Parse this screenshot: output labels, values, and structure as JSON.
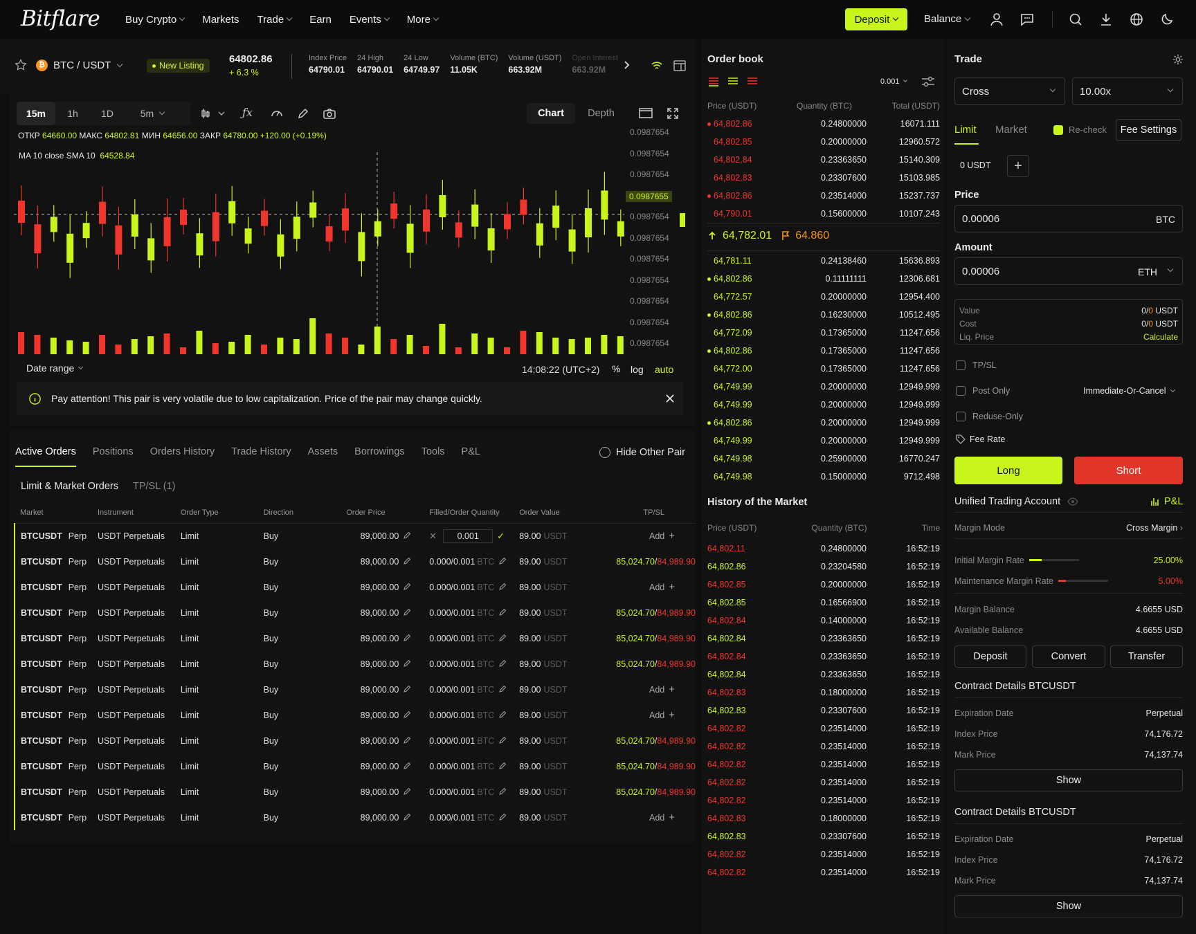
{
  "brand": "Bitflare",
  "nav": [
    "Buy Crypto",
    "Markets",
    "Trade",
    "Earn",
    "Events",
    "More"
  ],
  "nav_has_chevron": [
    true,
    false,
    true,
    false,
    true,
    true
  ],
  "header": {
    "deposit": "Deposit",
    "balance": "Balance"
  },
  "pair": {
    "symbol": "BTC / USDT",
    "badge": "New Listing",
    "price": "64802.86",
    "change": "+ 6.3 %",
    "stats": [
      {
        "label": "Index Price",
        "value": "64790.01"
      },
      {
        "label": "24 High",
        "value": "64790.01"
      },
      {
        "label": "24 Low",
        "value": "64749.97"
      },
      {
        "label": "Volume (BTC)",
        "value": "11.05K"
      },
      {
        "label": "Volume (USDT)",
        "value": "663.92M"
      },
      {
        "label": "Open Interest",
        "value": "663.92M"
      }
    ]
  },
  "chart_toolbar": {
    "intervals": [
      "15m",
      "1h",
      "1D",
      "5m"
    ],
    "active": "15m",
    "views": [
      "Chart",
      "Depth"
    ],
    "active_view": "Chart"
  },
  "ohlc": {
    "o_label": "ОТКР",
    "o": "64660.00",
    "h_label": "МАКС",
    "h": "64802.81",
    "l_label": "МИН",
    "l": "64656.00",
    "c_label": "ЗАКР",
    "c": "64780.00",
    "chg": "+120.00 (+0.19%)"
  },
  "ma": {
    "label": "MA 10 close SMA 10",
    "value": "64528.84"
  },
  "price_axis": [
    "0.0987654",
    "0.0987654",
    "0.0987654",
    "0.0987655",
    "0.0987654",
    "0.0987654",
    "0.0987654",
    "0.0987654",
    "0.0987654",
    "0.0987654",
    "0.0987654"
  ],
  "chart_bottom": {
    "date_range": "Date range",
    "time": "14:08:22 (UTC+2)",
    "pct": "%",
    "log": "log",
    "auto": "auto"
  },
  "warning": "Pay attention! This pair is very volatile due to low capitalization. Price of the pair may change quickly.",
  "orders": {
    "tabs": [
      "Active Orders",
      "Positions",
      "Orders History",
      "Trade History",
      "Assets",
      "Borrowings",
      "Tools",
      "P&L"
    ],
    "active_tab": "Active Orders",
    "hide_other": "Hide Other Pair",
    "subtabs": [
      "Limit & Market Orders",
      "TP/SL (1)"
    ],
    "columns": [
      "Market",
      "Instrument",
      "Order Type",
      "Direction",
      "Order Price",
      "Filled/Order Quantity",
      "Order Value",
      "TP/SL"
    ],
    "rows": [
      {
        "market": "BTCUSDT",
        "kind": "Perp",
        "instrument": "USDT Perpetuals",
        "type": "Limit",
        "dir": "Buy",
        "price": "89,000.00",
        "qty": "",
        "value": "89.00",
        "unit": "USDT",
        "tp": "",
        "sl": "",
        "add": "Add",
        "edit_qty": "0.001"
      },
      {
        "market": "BTCUSDT",
        "kind": "Perp",
        "instrument": "USDT Perpetuals",
        "type": "Limit",
        "dir": "Buy",
        "price": "89,000.00",
        "qty": "0.000/0.001",
        "value": "89.00",
        "unit": "USDT",
        "tp": "85,024.70",
        "sl": "84,989.90",
        "add": ""
      },
      {
        "market": "BTCUSDT",
        "kind": "Perp",
        "instrument": "USDT Perpetuals",
        "type": "Limit",
        "dir": "Buy",
        "price": "89,000.00",
        "qty": "0.000/0.001",
        "value": "89.00",
        "unit": "USDT",
        "tp": "",
        "sl": "",
        "add": "Add"
      },
      {
        "market": "BTCUSDT",
        "kind": "Perp",
        "instrument": "USDT Perpetuals",
        "type": "Limit",
        "dir": "Buy",
        "price": "89,000.00",
        "qty": "0.000/0.001",
        "value": "89.00",
        "unit": "USDT",
        "tp": "85,024.70",
        "sl": "84,989.90",
        "add": ""
      },
      {
        "market": "BTCUSDT",
        "kind": "Perp",
        "instrument": "USDT Perpetuals",
        "type": "Limit",
        "dir": "Buy",
        "price": "89,000.00",
        "qty": "0.000/0.001",
        "value": "89.00",
        "unit": "USDT",
        "tp": "85,024.70",
        "sl": "84,989.90",
        "add": ""
      },
      {
        "market": "BTCUSDT",
        "kind": "Perp",
        "instrument": "USDT Perpetuals",
        "type": "Limit",
        "dir": "Buy",
        "price": "89,000.00",
        "qty": "0.000/0.001",
        "value": "89.00",
        "unit": "USDT",
        "tp": "85,024.70",
        "sl": "84,989.90",
        "add": ""
      },
      {
        "market": "BTCUSDT",
        "kind": "Perp",
        "instrument": "USDT Perpetuals",
        "type": "Limit",
        "dir": "Buy",
        "price": "89,000.00",
        "qty": "0.000/0.001",
        "value": "89.00",
        "unit": "USDT",
        "tp": "",
        "sl": "",
        "add": "Add"
      },
      {
        "market": "BTCUSDT",
        "kind": "Perp",
        "instrument": "USDT Perpetuals",
        "type": "Limit",
        "dir": "Buy",
        "price": "89,000.00",
        "qty": "0.000/0.001",
        "value": "89.00",
        "unit": "USDT",
        "tp": "",
        "sl": "",
        "add": "Add"
      },
      {
        "market": "BTCUSDT",
        "kind": "Perp",
        "instrument": "USDT Perpetuals",
        "type": "Limit",
        "dir": "Buy",
        "price": "89,000.00",
        "qty": "0.000/0.001",
        "value": "89.00",
        "unit": "USDT",
        "tp": "85,024.70",
        "sl": "84,989.90",
        "add": ""
      },
      {
        "market": "BTCUSDT",
        "kind": "Perp",
        "instrument": "USDT Perpetuals",
        "type": "Limit",
        "dir": "Buy",
        "price": "89,000.00",
        "qty": "0.000/0.001",
        "value": "89.00",
        "unit": "USDT",
        "tp": "85,024.70",
        "sl": "84,989.90",
        "add": ""
      },
      {
        "market": "BTCUSDT",
        "kind": "Perp",
        "instrument": "USDT Perpetuals",
        "type": "Limit",
        "dir": "Buy",
        "price": "89,000.00",
        "qty": "0.000/0.001",
        "value": "89.00",
        "unit": "USDT",
        "tp": "85,024.70",
        "sl": "84,989.90",
        "add": ""
      },
      {
        "market": "BTCUSDT",
        "kind": "Perp",
        "instrument": "USDT Perpetuals",
        "type": "Limit",
        "dir": "Buy",
        "price": "89,000.00",
        "qty": "0.000/0.001",
        "value": "89.00",
        "unit": "USDT",
        "tp": "",
        "sl": "",
        "add": "Add"
      }
    ]
  },
  "orderbook": {
    "title": "Order book",
    "precision": "0.001",
    "columns": [
      "Price (USDT)",
      "Quantity (BTC)",
      "Total (USDT)"
    ],
    "asks": [
      [
        "64,802.86",
        "0.24800000",
        "16071.111",
        true
      ],
      [
        "64,802.85",
        "0.20000000",
        "12960.572",
        false
      ],
      [
        "64,802.84",
        "0.23363650",
        "15140.309",
        false
      ],
      [
        "64,802.83",
        "0.23307600",
        "15103.985",
        false
      ],
      [
        "64,802.86",
        "0.23514000",
        "15237.737",
        true
      ],
      [
        "64,790.01",
        "0.15600000",
        "10107.243",
        false
      ]
    ],
    "last_price": "64,782.01",
    "mark_price": "64.860",
    "bids": [
      [
        "64,781.11",
        "0.24138460",
        "15636.893",
        false
      ],
      [
        "64,802.86",
        "0.11111111",
        "12306.681",
        true
      ],
      [
        "64,772.57",
        "0.20000000",
        "12954.400",
        false
      ],
      [
        "64,802.86",
        "0.16230000",
        "10512.495",
        true
      ],
      [
        "64,772.09",
        "0.17365000",
        "11247.656",
        false
      ],
      [
        "64,802.86",
        "0.17365000",
        "11247.656",
        true
      ],
      [
        "64,772.00",
        "0.17365000",
        "11247.656",
        false
      ],
      [
        "64,749.99",
        "0.20000000",
        "12949.999",
        false
      ],
      [
        "64,749.99",
        "0.20000000",
        "12949.999",
        false
      ],
      [
        "64,802.86",
        "0.20000000",
        "12949.999",
        true
      ],
      [
        "64,749.99",
        "0.20000000",
        "12949.999",
        false
      ],
      [
        "64,749.98",
        "0.25900000",
        "16770.247",
        false
      ],
      [
        "64,749.98",
        "0.15000000",
        "9712.498",
        false
      ]
    ]
  },
  "history": {
    "title": "History of the Market",
    "columns": [
      "Price (USDT)",
      "Quantity (BTC)",
      "Time"
    ],
    "rows": [
      [
        "64,802.11",
        "0.24800000",
        "16:52:19",
        "r"
      ],
      [
        "64,802.86",
        "0.23204580",
        "16:52:19",
        "g"
      ],
      [
        "64,802.85",
        "0.20000000",
        "16:52:19",
        "r"
      ],
      [
        "64,802.85",
        "0.16566900",
        "16:52:19",
        "g"
      ],
      [
        "64,802.84",
        "0.14000000",
        "16:52:19",
        "r"
      ],
      [
        "64,802.84",
        "0.23363650",
        "16:52:19",
        "g"
      ],
      [
        "64,802.84",
        "0.23363650",
        "16:52:19",
        "r"
      ],
      [
        "64,802.84",
        "0.23363650",
        "16:52:19",
        "g"
      ],
      [
        "64,802.83",
        "0.18000000",
        "16:52:19",
        "r"
      ],
      [
        "64,802.83",
        "0.23307600",
        "16:52:19",
        "g"
      ],
      [
        "64,802.82",
        "0.23514000",
        "16:52:19",
        "r"
      ],
      [
        "64,802.82",
        "0.23514000",
        "16:52:19",
        "r"
      ],
      [
        "64,802.82",
        "0.23514000",
        "16:52:19",
        "r"
      ],
      [
        "64,802.82",
        "0.23514000",
        "16:52:19",
        "r"
      ],
      [
        "64,802.82",
        "0.23514000",
        "16:52:19",
        "r"
      ],
      [
        "64,802.83",
        "0.18000000",
        "16:52:19",
        "r"
      ],
      [
        "64,802.83",
        "0.23307600",
        "16:52:19",
        "g"
      ],
      [
        "64,802.82",
        "0.23514000",
        "16:52:19",
        "r"
      ],
      [
        "64,802.82",
        "0.23514000",
        "16:52:19",
        "r"
      ]
    ]
  },
  "trade": {
    "title": "Trade",
    "margin_mode": "Cross",
    "leverage": "10.00x",
    "tabs": [
      "Limit",
      "Market"
    ],
    "recheck": "Re-check",
    "fee_settings": "Fee Settings",
    "avail": "0 USDT",
    "price_label": "Price",
    "price": "0.00006",
    "price_unit": "BTC",
    "amount_label": "Amount",
    "amount": "0.00006",
    "amount_unit": "ETH",
    "info": [
      {
        "label": "Value",
        "a": "0",
        "b": "0",
        "unit": "USDT"
      },
      {
        "label": "Cost",
        "a": "0",
        "b": "0",
        "unit": "USDT"
      }
    ],
    "liq_label": "Liq. Price",
    "liq_action": "Calculate",
    "tpsl": "TP/SL",
    "post_only": "Post Only",
    "tif": "Immediate-Or-Cancel",
    "reduce": "Reduse-Only",
    "fee_rate": "Fee Rate",
    "long": "Long",
    "short": "Short",
    "uta": "Unified Trading Account",
    "pnl": "P&L",
    "margin_mode_label": "Margin Mode",
    "margin_mode_value": "Cross Margin",
    "imr_label": "Initial Margin Rate",
    "imr": "25.00%",
    "imr_fill": 0.25,
    "mmr_label": "Maintenance Margin Rate",
    "mmr": "5.00%",
    "mmr_fill": 0.05,
    "mb_label": "Margin Balance",
    "mb": "4.6655 USD",
    "ab_label": "Available Balance",
    "ab": "4.6655 USD",
    "actions": [
      "Deposit",
      "Convert",
      "Transfer"
    ],
    "contracts": [
      {
        "title": "Contract Details BTCUSDT",
        "exp_label": "Expiration Date",
        "exp": "Perpetual",
        "idx_label": "Index Price",
        "idx": "74,176.72",
        "mark_label": "Mark Price",
        "mark": "74,137.74",
        "show": "Show"
      },
      {
        "title": "Contract Details BTCUSDT",
        "exp_label": "Expiration Date",
        "exp": "Perpetual",
        "idx_label": "Index Price",
        "idx": "74,176.72",
        "mark_label": "Mark Price",
        "mark": "74,137.74",
        "show": "Show"
      }
    ]
  },
  "colors": {
    "accent": "#c8f51c",
    "down": "#f0352c",
    "bg": "#0f0f0f",
    "panel": "#121212"
  },
  "chart_data": {
    "type": "candlestick",
    "price_tag": "0.0987655",
    "candles": [
      [
        2,
        -1
      ],
      [
        3,
        -1
      ],
      [
        1,
        1
      ],
      [
        3,
        1
      ],
      [
        1,
        1
      ],
      [
        2,
        -1
      ],
      [
        3,
        -1
      ],
      [
        2,
        1
      ],
      [
        2,
        1
      ],
      [
        3,
        -1
      ],
      [
        1,
        -1
      ],
      [
        2,
        1
      ],
      [
        3,
        -1
      ],
      [
        2,
        1
      ],
      [
        1,
        1
      ],
      [
        1,
        -1
      ],
      [
        2,
        1
      ],
      [
        2,
        1
      ],
      [
        1,
        1
      ],
      [
        1,
        -1
      ],
      [
        2,
        -1
      ],
      [
        3,
        1
      ],
      [
        1,
        1
      ],
      [
        1,
        -1
      ],
      [
        3,
        1
      ],
      [
        2,
        -1
      ],
      [
        2,
        1
      ],
      [
        1,
        -1
      ],
      [
        2,
        1
      ],
      [
        2,
        1
      ],
      [
        1,
        -1
      ],
      [
        1,
        -1
      ],
      [
        2,
        1
      ],
      [
        2,
        1
      ],
      [
        2,
        1
      ],
      [
        3,
        1
      ],
      [
        3,
        1
      ],
      [
        1,
        1
      ]
    ]
  }
}
